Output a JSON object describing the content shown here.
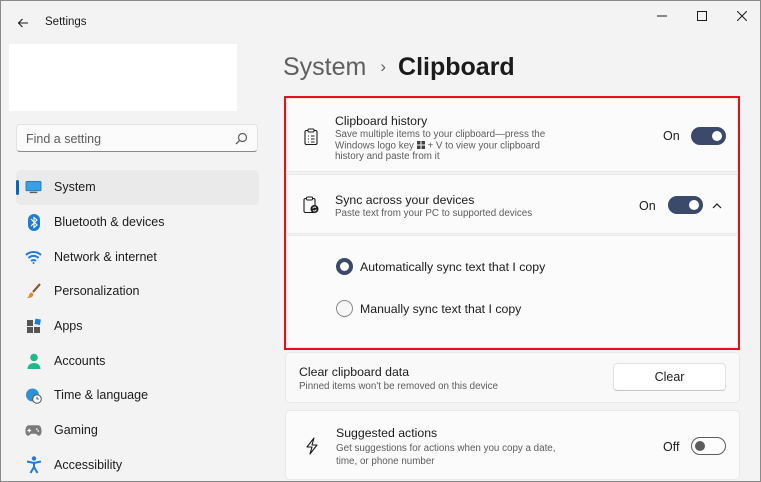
{
  "window": {
    "title": "Settings",
    "controls": {
      "minimize": "minimize-icon",
      "maximize": "maximize-icon",
      "close": "close-icon"
    }
  },
  "search": {
    "placeholder": "Find a setting"
  },
  "sidebar": {
    "items": [
      {
        "label": "System",
        "icon": "system-icon",
        "selected": true
      },
      {
        "label": "Bluetooth & devices",
        "icon": "bluetooth-icon"
      },
      {
        "label": "Network & internet",
        "icon": "wifi-icon"
      },
      {
        "label": "Personalization",
        "icon": "brush-icon"
      },
      {
        "label": "Apps",
        "icon": "apps-icon"
      },
      {
        "label": "Accounts",
        "icon": "person-icon"
      },
      {
        "label": "Time & language",
        "icon": "globe-clock-icon"
      },
      {
        "label": "Gaming",
        "icon": "gamepad-icon"
      },
      {
        "label": "Accessibility",
        "icon": "accessibility-icon"
      }
    ]
  },
  "breadcrumb": {
    "parent": "System",
    "separator": "›",
    "current": "Clipboard"
  },
  "clipboard_history": {
    "title": "Clipboard history",
    "desc_line1": "Save multiple items to your clipboard—press the",
    "desc_line2a": "Windows logo key",
    "desc_line2b": "+ V to view your clipboard",
    "desc_line3": "history and paste from it",
    "state": "On",
    "enabled": true
  },
  "sync": {
    "title": "Sync across your devices",
    "desc": "Paste text from your PC to supported devices",
    "state": "On",
    "enabled": true,
    "expanded": true,
    "options": [
      {
        "label": "Automatically sync text that I copy",
        "selected": true
      },
      {
        "label": "Manually sync text that I copy",
        "selected": false
      }
    ]
  },
  "clear_data": {
    "title": "Clear clipboard data",
    "desc": "Pinned items won't be removed on this device",
    "button": "Clear"
  },
  "suggested": {
    "title": "Suggested actions",
    "desc_line1": "Get suggestions for actions when you copy a date,",
    "desc_line2": "time, or phone number",
    "state": "Off",
    "enabled": false
  },
  "colors": {
    "accent": "#3b4a6b",
    "highlight": "#e3111b",
    "selection": "#0067c0"
  }
}
